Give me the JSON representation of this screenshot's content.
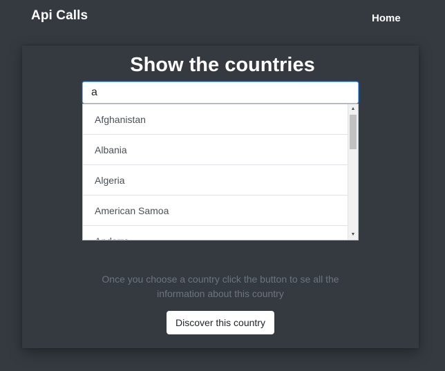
{
  "navbar": {
    "brand": "Api Calls",
    "links": [
      {
        "label": "Home"
      }
    ]
  },
  "main": {
    "title": "Show the countries",
    "search": {
      "value": "a",
      "placeholder": ""
    },
    "suggestions": [
      "Afghanistan",
      "Albania",
      "Algeria",
      "American Samoa",
      "Andorra"
    ],
    "helper_text": "Once you choose a country click the button to se all the information about this country",
    "button_label": "Discover this country"
  },
  "colors": {
    "background": "#343a40",
    "text": "#ffffff",
    "muted": "#6c757d",
    "input_focus_border": "#80bdff"
  }
}
